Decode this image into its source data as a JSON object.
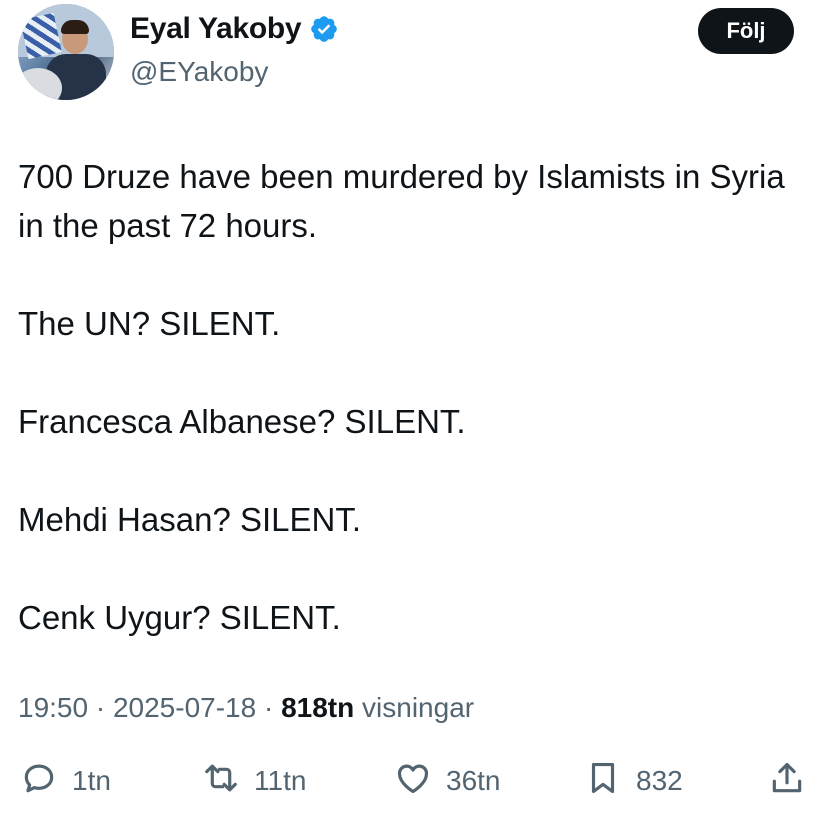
{
  "author": {
    "display_name": "Eyal Yakoby",
    "handle": "@EYakoby",
    "verified": true,
    "verified_color": "#1d9bf0"
  },
  "follow_button": {
    "label": "Följ"
  },
  "tweet": {
    "paragraphs": [
      "700 Druze have been murdered by Islamists in Syria in the past 72 hours.",
      "The UN? SILENT.",
      "Francesca Albanese? SILENT.",
      "Mehdi Hasan? SILENT.",
      "Cenk Uygur? SILENT."
    ]
  },
  "meta": {
    "time": "19:50",
    "separator": " · ",
    "date": "2025-07-18",
    "views_count": "818tn",
    "views_label": "visningar"
  },
  "actions": {
    "reply": {
      "icon": "reply-icon",
      "count": "1tn"
    },
    "retweet": {
      "icon": "retweet-icon",
      "count": "11tn"
    },
    "like": {
      "icon": "heart-icon",
      "count": "36tn"
    },
    "bookmark": {
      "icon": "bookmark-icon",
      "count": "832"
    },
    "share": {
      "icon": "share-icon"
    }
  },
  "colors": {
    "text_primary": "#0f1419",
    "text_secondary": "#536471",
    "button_bg": "#0f1419"
  }
}
